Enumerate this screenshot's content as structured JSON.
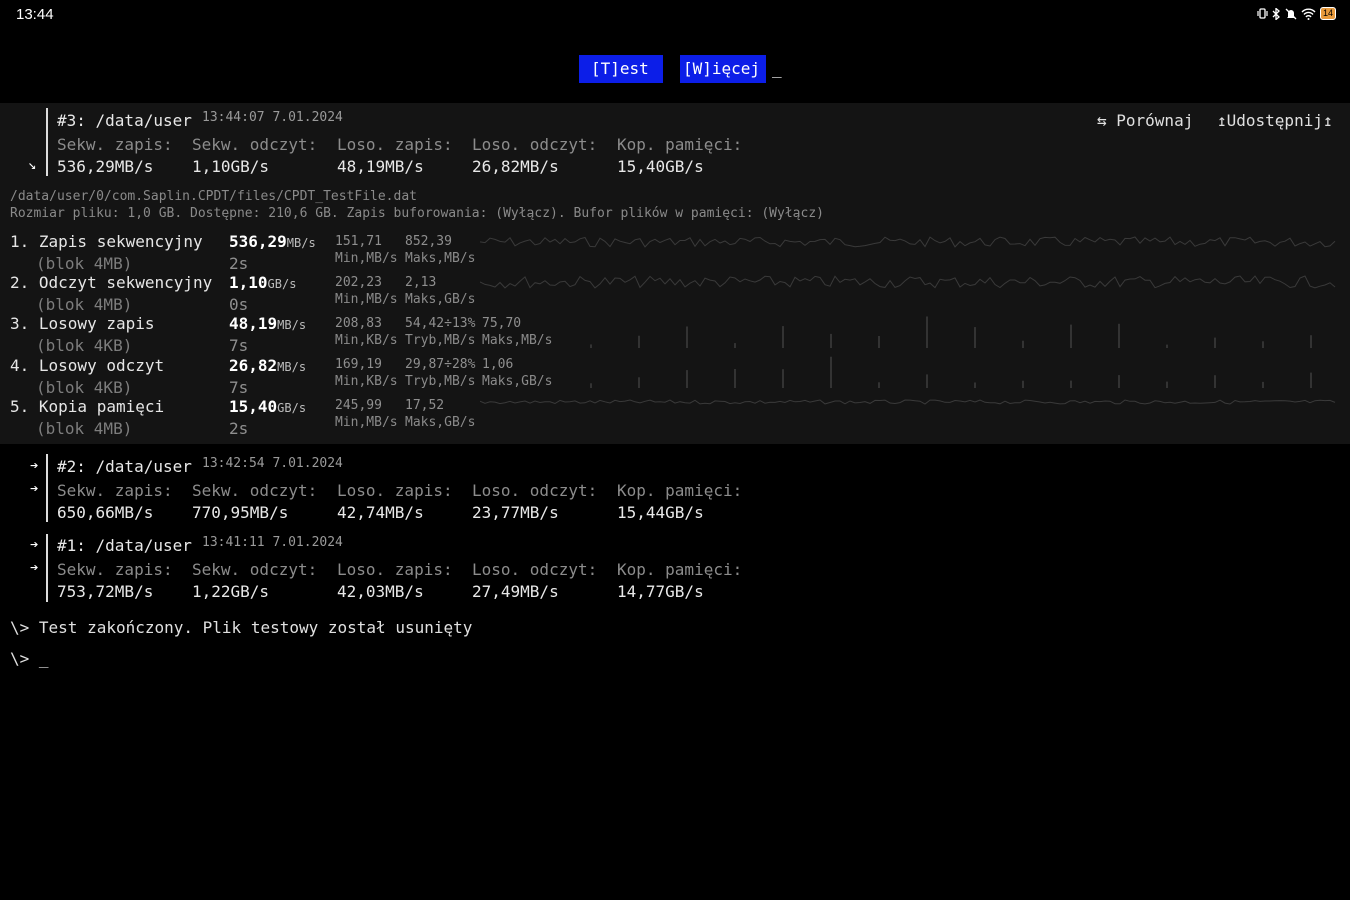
{
  "status_bar": {
    "time": "13:44",
    "battery": "14",
    "icons": [
      "vibrate-icon",
      "bluetooth-icon",
      "mute-icon",
      "wifi-icon",
      "battery-icon"
    ]
  },
  "top_buttons": {
    "test_label": "[T]est",
    "more_label": "[W]ięcej",
    "cursor": "_"
  },
  "current_result": {
    "title": "#3: /data/user",
    "timestamp": "13:44:07 7.01.2024",
    "arrow": "↘",
    "compare_label": "⇆ Porównaj",
    "share_label": "↥Udostępnij↥",
    "labels": [
      "Sekw. zapis:",
      "Sekw. odczyt:",
      "Loso. zapis:",
      "Loso. odczyt:",
      "Kop. pamięci:"
    ],
    "values": [
      "536,29MB/s",
      "1,10GB/s",
      "48,19MB/s",
      "26,82MB/s",
      "15,40GB/s"
    ],
    "file_path": "/data/user/0/com.Saplin.CPDT/files/CPDT_TestFile.dat",
    "file_info": "Rozmiar pliku: 1,0 GB. Dostępne: 210,6 GB. Zapis buforowania: (Wyłącz). Bufor plików w pamięci: (Wyłącz)",
    "tests": [
      {
        "name": "1. Zapis sekwencyjny",
        "sub": "(blok 4MB)",
        "value": "536,29",
        "unit": "MB/s",
        "time": "2s",
        "stats": [
          {
            "num": "151,71",
            "lbl": "Min,MB/s"
          },
          {
            "num": "852,39",
            "lbl": "Maks,MB/s"
          }
        ]
      },
      {
        "name": "2. Odczyt sekwencyjny",
        "sub": "(blok 4MB)",
        "value": "1,10",
        "unit": "GB/s",
        "time": "0s",
        "stats": [
          {
            "num": "202,23",
            "lbl": "Min,MB/s"
          },
          {
            "num": "2,13",
            "lbl": "Maks,GB/s"
          }
        ]
      },
      {
        "name": "3. Losowy zapis",
        "sub": "(blok 4KB)",
        "value": "48,19",
        "unit": "MB/s",
        "time": "7s",
        "stats": [
          {
            "num": "208,83",
            "lbl": "Min,KB/s"
          },
          {
            "num": "54,42÷13%",
            "lbl": "Tryb,MB/s"
          },
          {
            "num": "75,70",
            "lbl": "Maks,MB/s"
          }
        ]
      },
      {
        "name": "4. Losowy odczyt",
        "sub": "(blok 4KB)",
        "value": "26,82",
        "unit": "MB/s",
        "time": "7s",
        "stats": [
          {
            "num": "169,19",
            "lbl": "Min,KB/s"
          },
          {
            "num": "29,87÷28%",
            "lbl": "Tryb,MB/s"
          },
          {
            "num": "1,06",
            "lbl": "Maks,GB/s"
          }
        ]
      },
      {
        "name": "5. Kopia pamięci",
        "sub": "(blok 4MB)",
        "value": "15,40",
        "unit": "GB/s",
        "time": "2s",
        "stats": [
          {
            "num": "245,99",
            "lbl": "Min,MB/s"
          },
          {
            "num": "17,52",
            "lbl": "Maks,GB/s"
          }
        ]
      }
    ]
  },
  "history": [
    {
      "title": "#2: /data/user",
      "timestamp": "13:42:54 7.01.2024",
      "arrow": "➔",
      "labels": [
        "Sekw. zapis:",
        "Sekw. odczyt:",
        "Loso. zapis:",
        "Loso. odczyt:",
        "Kop. pamięci:"
      ],
      "values": [
        "650,66MB/s",
        "770,95MB/s",
        "42,74MB/s",
        "23,77MB/s",
        "15,44GB/s"
      ]
    },
    {
      "title": "#1: /data/user",
      "timestamp": "13:41:11 7.01.2024",
      "arrow": "➔",
      "labels": [
        "Sekw. zapis:",
        "Sekw. odczyt:",
        "Loso. zapis:",
        "Loso. odczyt:",
        "Kop. pamięci:"
      ],
      "values": [
        "753,72MB/s",
        "1,22GB/s",
        "42,03MB/s",
        "27,49MB/s",
        "14,77GB/s"
      ]
    }
  ],
  "console": {
    "line1": "\\> Test zakończony. Plik testowy został usunięty",
    "line2": "\\> _"
  }
}
